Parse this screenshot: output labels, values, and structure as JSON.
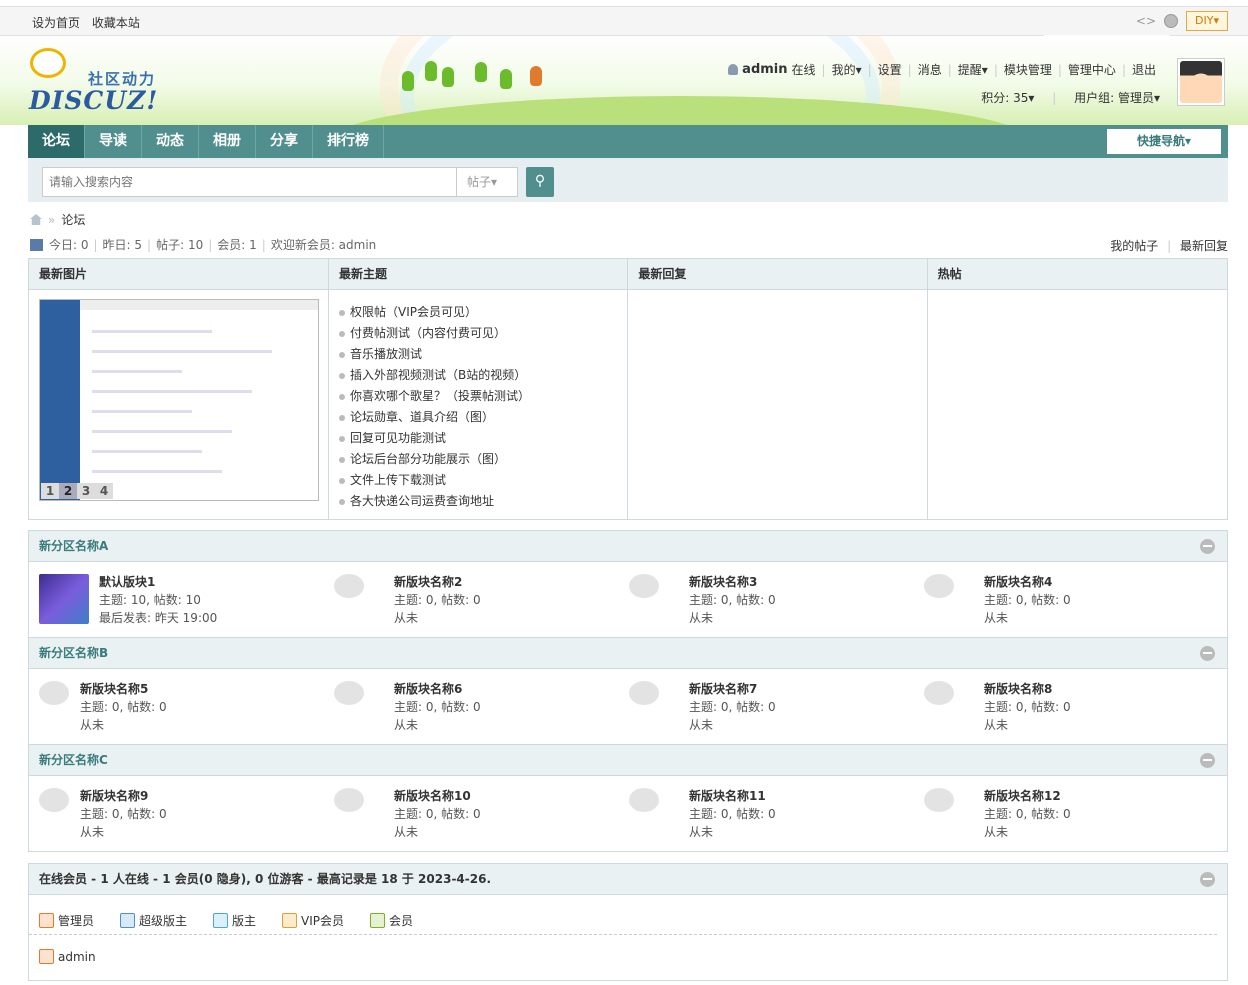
{
  "topbar": {
    "set_home": "设为首页",
    "bookmark": "收藏本站",
    "code_icon": "<>",
    "diy": "DIY▾"
  },
  "swatches": [
    "#4a7fc5",
    "#b23a1f",
    "#3f8b8b",
    "#e8952b",
    "#9646b4",
    "#2a5ab2"
  ],
  "logo": {
    "tagline": "社区动力",
    "brand": "DISCUZ!"
  },
  "user": {
    "name": "admin",
    "status": "在线",
    "links": [
      "我的▾",
      "设置",
      "消息",
      "提醒▾",
      "模块管理",
      "管理中心",
      "退出"
    ],
    "credits": "积分: 35▾",
    "group": "用户组: 管理员▾"
  },
  "nav": {
    "items": [
      "论坛",
      "导读",
      "动态",
      "相册",
      "分享",
      "排行榜"
    ],
    "quick": "快捷导航▾"
  },
  "search": {
    "placeholder": "请输入搜索内容",
    "type": "帖子▾",
    "button_icon": "⚲"
  },
  "breadcrumb": {
    "current": "论坛",
    "sep": "»"
  },
  "stats": {
    "today": "今日: 0",
    "yesterday": "昨日: 5",
    "posts": "帖子: 10",
    "members": "会员: 1",
    "newest": "欢迎新会员: admin",
    "my_posts": "我的帖子",
    "latest_replies": "最新回复"
  },
  "boxes": {
    "images_title": "最新图片",
    "topics_title": "最新主题",
    "replies_title": "最新回复",
    "hot_title": "热帖",
    "pager": [
      "1",
      "2",
      "3",
      "4"
    ],
    "topics": [
      "权限帖（VIP会员可见）",
      "付费帖测试（内容付费可见）",
      "音乐播放测试",
      "插入外部视频测试（B站的视频）",
      "你喜欢哪个歌星？（投票帖测试）",
      "论坛勋章、道具介绍（图）",
      "回复可见功能测试",
      "论坛后台部分功能展示（图）",
      "文件上传下载测试",
      "各大快递公司运费查询地址"
    ]
  },
  "categories": [
    {
      "title": "新分区名称A",
      "forums": [
        {
          "name": "默认版块1",
          "stats": "主题: 10, 帖数: 10",
          "last": "最后发表: 昨天 19:00"
        },
        {
          "name": "新版块名称2",
          "stats": "主题: 0, 帖数: 0",
          "last": "从未"
        },
        {
          "name": "新版块名称3",
          "stats": "主题: 0, 帖数: 0",
          "last": "从未"
        },
        {
          "name": "新版块名称4",
          "stats": "主题: 0, 帖数: 0",
          "last": "从未"
        }
      ]
    },
    {
      "title": "新分区名称B",
      "forums": [
        {
          "name": "新版块名称5",
          "stats": "主题: 0, 帖数: 0",
          "last": "从未"
        },
        {
          "name": "新版块名称6",
          "stats": "主题: 0, 帖数: 0",
          "last": "从未"
        },
        {
          "name": "新版块名称7",
          "stats": "主题: 0, 帖数: 0",
          "last": "从未"
        },
        {
          "name": "新版块名称8",
          "stats": "主题: 0, 帖数: 0",
          "last": "从未"
        }
      ]
    },
    {
      "title": "新分区名称C",
      "forums": [
        {
          "name": "新版块名称9",
          "stats": "主题: 0, 帖数: 0",
          "last": "从未"
        },
        {
          "name": "新版块名称10",
          "stats": "主题: 0, 帖数: 0",
          "last": "从未"
        },
        {
          "name": "新版块名称11",
          "stats": "主题: 0, 帖数: 0",
          "last": "从未"
        },
        {
          "name": "新版块名称12",
          "stats": "主题: 0, 帖数: 0",
          "last": "从未"
        }
      ]
    }
  ],
  "online": {
    "title": "在线会员 - 1 人在线 - 1 会员(0 隐身), 0 位游客 - 最高记录是 18 于 2023-4-26.",
    "legend": [
      {
        "label": "管理员",
        "color": "#e07a2c"
      },
      {
        "label": "超级版主",
        "color": "#4a8fd0"
      },
      {
        "label": "版主",
        "color": "#4aa6d8"
      },
      {
        "label": "VIP会员",
        "color": "#e0a030"
      },
      {
        "label": "会员",
        "color": "#7cae2a"
      }
    ],
    "users": [
      "admin"
    ]
  }
}
